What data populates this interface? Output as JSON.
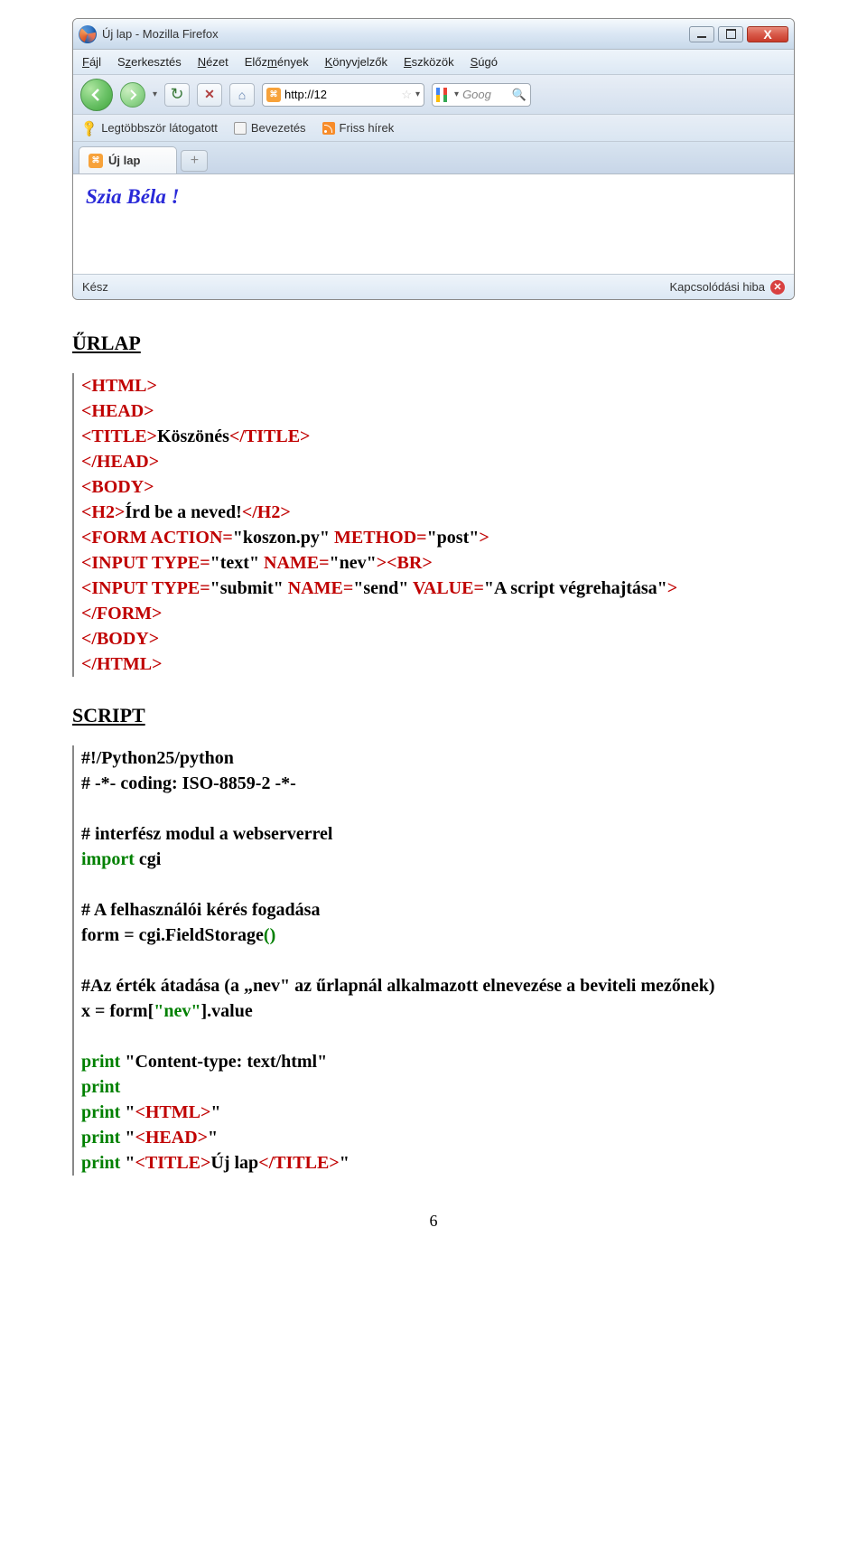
{
  "browser": {
    "title_text": "Új lap - Mozilla Firefox",
    "menu": {
      "file": "<span class='u'>F</span>ájl",
      "edit": "S<span class='u'>z</span>erkesztés",
      "view": "<span class='u'>N</span>ézet",
      "history": "Előz<span class='u'>m</span>ények",
      "bookmarks": "<span class='u'>K</span>önyvjelzők",
      "tools": "<span class='u'>E</span>szközök",
      "help": "<span class='u'>S</span>úgó"
    },
    "address_text": "http://12",
    "search_placeholder": "Goog",
    "bookmarks": {
      "most_visited": "Legtöbbször látogatott",
      "intro": "Bevezetés",
      "news": "Friss hírek"
    },
    "tab_label": "Új lap",
    "content_heading": "Szia Béla !",
    "status_left": "Kész",
    "status_right": "Kapcsolódási hiba"
  },
  "doc": {
    "section1": "ŰRLAP",
    "section2": "SCRIPT",
    "code1": {
      "l1": "<HTML>",
      "l2": "<HEAD>",
      "l3a": "<TITLE>",
      "l3b": "Köszönés",
      "l3c": "</TITLE>",
      "l4": "</HEAD>",
      "l5": "<BODY>",
      "l6a": "<H2>",
      "l6b": "Írd be a neved!",
      "l6c": "</H2>",
      "l7a": "<FORM ACTION=",
      "l7b": "\"koszon.py\"",
      "l7c": " METHOD=",
      "l7d": "\"post\"",
      "l7e": ">",
      "l8a": "<INPUT TYPE=",
      "l8b": "\"text\"",
      "l8c": " NAME=",
      "l8d": "\"nev\"",
      "l8e": "><BR>",
      "l9a": "<INPUT TYPE=",
      "l9b": "\"submit\"",
      "l9c": " NAME=",
      "l9d": "\"send\"",
      "l9e": " VALUE=",
      "l9f": "\"A script végrehajtása\"",
      "l9g": ">",
      "l10": "</FORM>",
      "l11": "</BODY>",
      "l12": "</HTML>"
    },
    "code2": {
      "l1": "#!/Python25/python",
      "l2": "# -*- coding: ISO-8859-2 -*-",
      "l3": "# interfész modul a webserverrel",
      "l4a": "import",
      "l4b": " cgi",
      "l5": "# A felhasználói kérés fogadása",
      "l6a": "form = cgi.FieldStorage",
      "l6b": "()",
      "l7": "#Az érték átadása (a „nev\" az űrlapnál alkalmazott elnevezése a beviteli mezőnek)",
      "l8a": "x = form[",
      "l8b": "\"nev\"",
      "l8c": "].value",
      "l9a": "print",
      "l9b": " \"Content-type: text/html\"",
      "l10": "print",
      "l11a": "print",
      "l11b": " \"",
      "l11c": "<HTML>",
      "l11d": "\"",
      "l12a": "print",
      "l12b": " \"",
      "l12c": "<HEAD>",
      "l12d": "\"",
      "l13a": "print",
      "l13b": " \"",
      "l13c": "<TITLE>",
      "l13d": "Új lap",
      "l13e": "</TITLE>",
      "l13f": "\""
    },
    "page_number": "6"
  }
}
